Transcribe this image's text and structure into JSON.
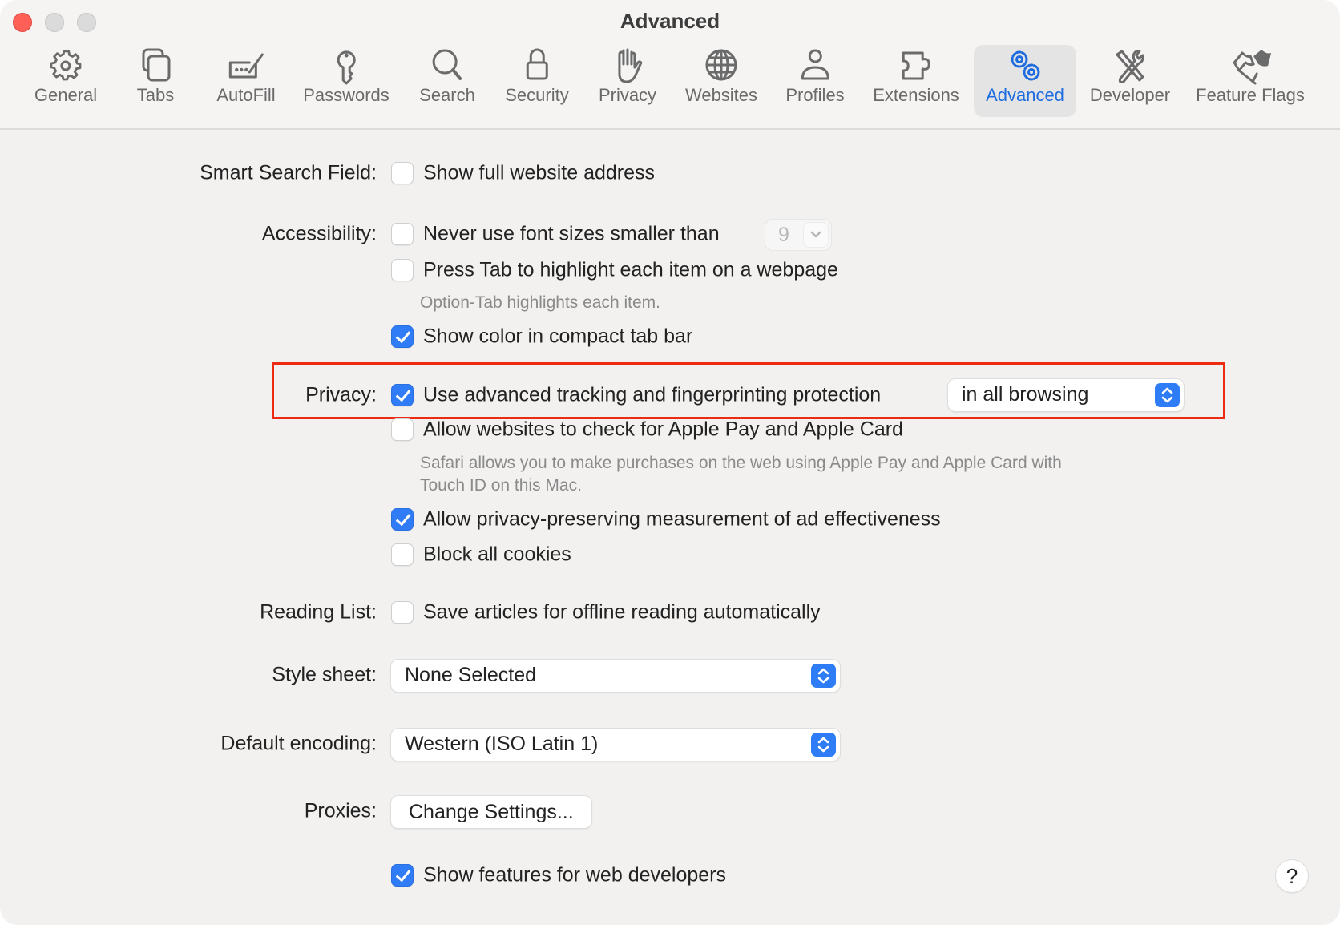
{
  "window": {
    "title": "Advanced",
    "traffic_lights": [
      "close",
      "minimize",
      "zoom"
    ]
  },
  "toolbar": {
    "selected": "Advanced",
    "accent_color": "#1d6ce0",
    "tabs": [
      {
        "label": "General",
        "icon": "gear-icon"
      },
      {
        "label": "Tabs",
        "icon": "tabs-icon"
      },
      {
        "label": "AutoFill",
        "icon": "autofill-icon"
      },
      {
        "label": "Passwords",
        "icon": "key-icon"
      },
      {
        "label": "Search",
        "icon": "magnifier-icon"
      },
      {
        "label": "Security",
        "icon": "lock-icon"
      },
      {
        "label": "Privacy",
        "icon": "hand-icon"
      },
      {
        "label": "Websites",
        "icon": "globe-icon"
      },
      {
        "label": "Profiles",
        "icon": "person-icon"
      },
      {
        "label": "Extensions",
        "icon": "puzzle-icon"
      },
      {
        "label": "Advanced",
        "icon": "gears-icon"
      },
      {
        "label": "Developer",
        "icon": "tools-icon"
      },
      {
        "label": "Feature Flags",
        "icon": "flags-icon"
      }
    ]
  },
  "settings": {
    "smart_search": {
      "label": "Smart Search Field:",
      "show_full_address": {
        "text": "Show full website address",
        "checked": false
      }
    },
    "accessibility": {
      "label": "Accessibility:",
      "min_font": {
        "text": "Never use font sizes smaller than",
        "checked": false,
        "value": "9"
      },
      "press_tab": {
        "text": "Press Tab to highlight each item on a webpage",
        "checked": false,
        "hint": "Option-Tab highlights each item."
      },
      "show_color": {
        "text": "Show color in compact tab bar",
        "checked": true
      }
    },
    "privacy": {
      "label": "Privacy:",
      "advanced_tracking": {
        "text": "Use advanced tracking and fingerprinting protection",
        "checked": true,
        "scope": "in all browsing"
      },
      "apple_pay": {
        "text": "Allow websites to check for Apple Pay and Apple Card",
        "checked": false,
        "hint_line1": "Safari allows you to make purchases on the web using Apple Pay and Apple Card with",
        "hint_line2": "Touch ID on this Mac."
      },
      "ad_measurement": {
        "text": "Allow privacy-preserving measurement of ad effectiveness",
        "checked": true
      },
      "block_cookies": {
        "text": "Block all cookies",
        "checked": false
      }
    },
    "reading_list": {
      "label": "Reading List:",
      "offline": {
        "text": "Save articles for offline reading automatically",
        "checked": false
      }
    },
    "style_sheet": {
      "label": "Style sheet:",
      "value": "None Selected"
    },
    "default_encoding": {
      "label": "Default encoding:",
      "value": "Western (ISO Latin 1)"
    },
    "proxies": {
      "label": "Proxies:",
      "button": "Change Settings..."
    },
    "developer": {
      "text": "Show features for web developers",
      "checked": true
    }
  },
  "help_button": "?",
  "highlight": {
    "target": "privacy.advanced_tracking",
    "color": "#ec2b12"
  }
}
